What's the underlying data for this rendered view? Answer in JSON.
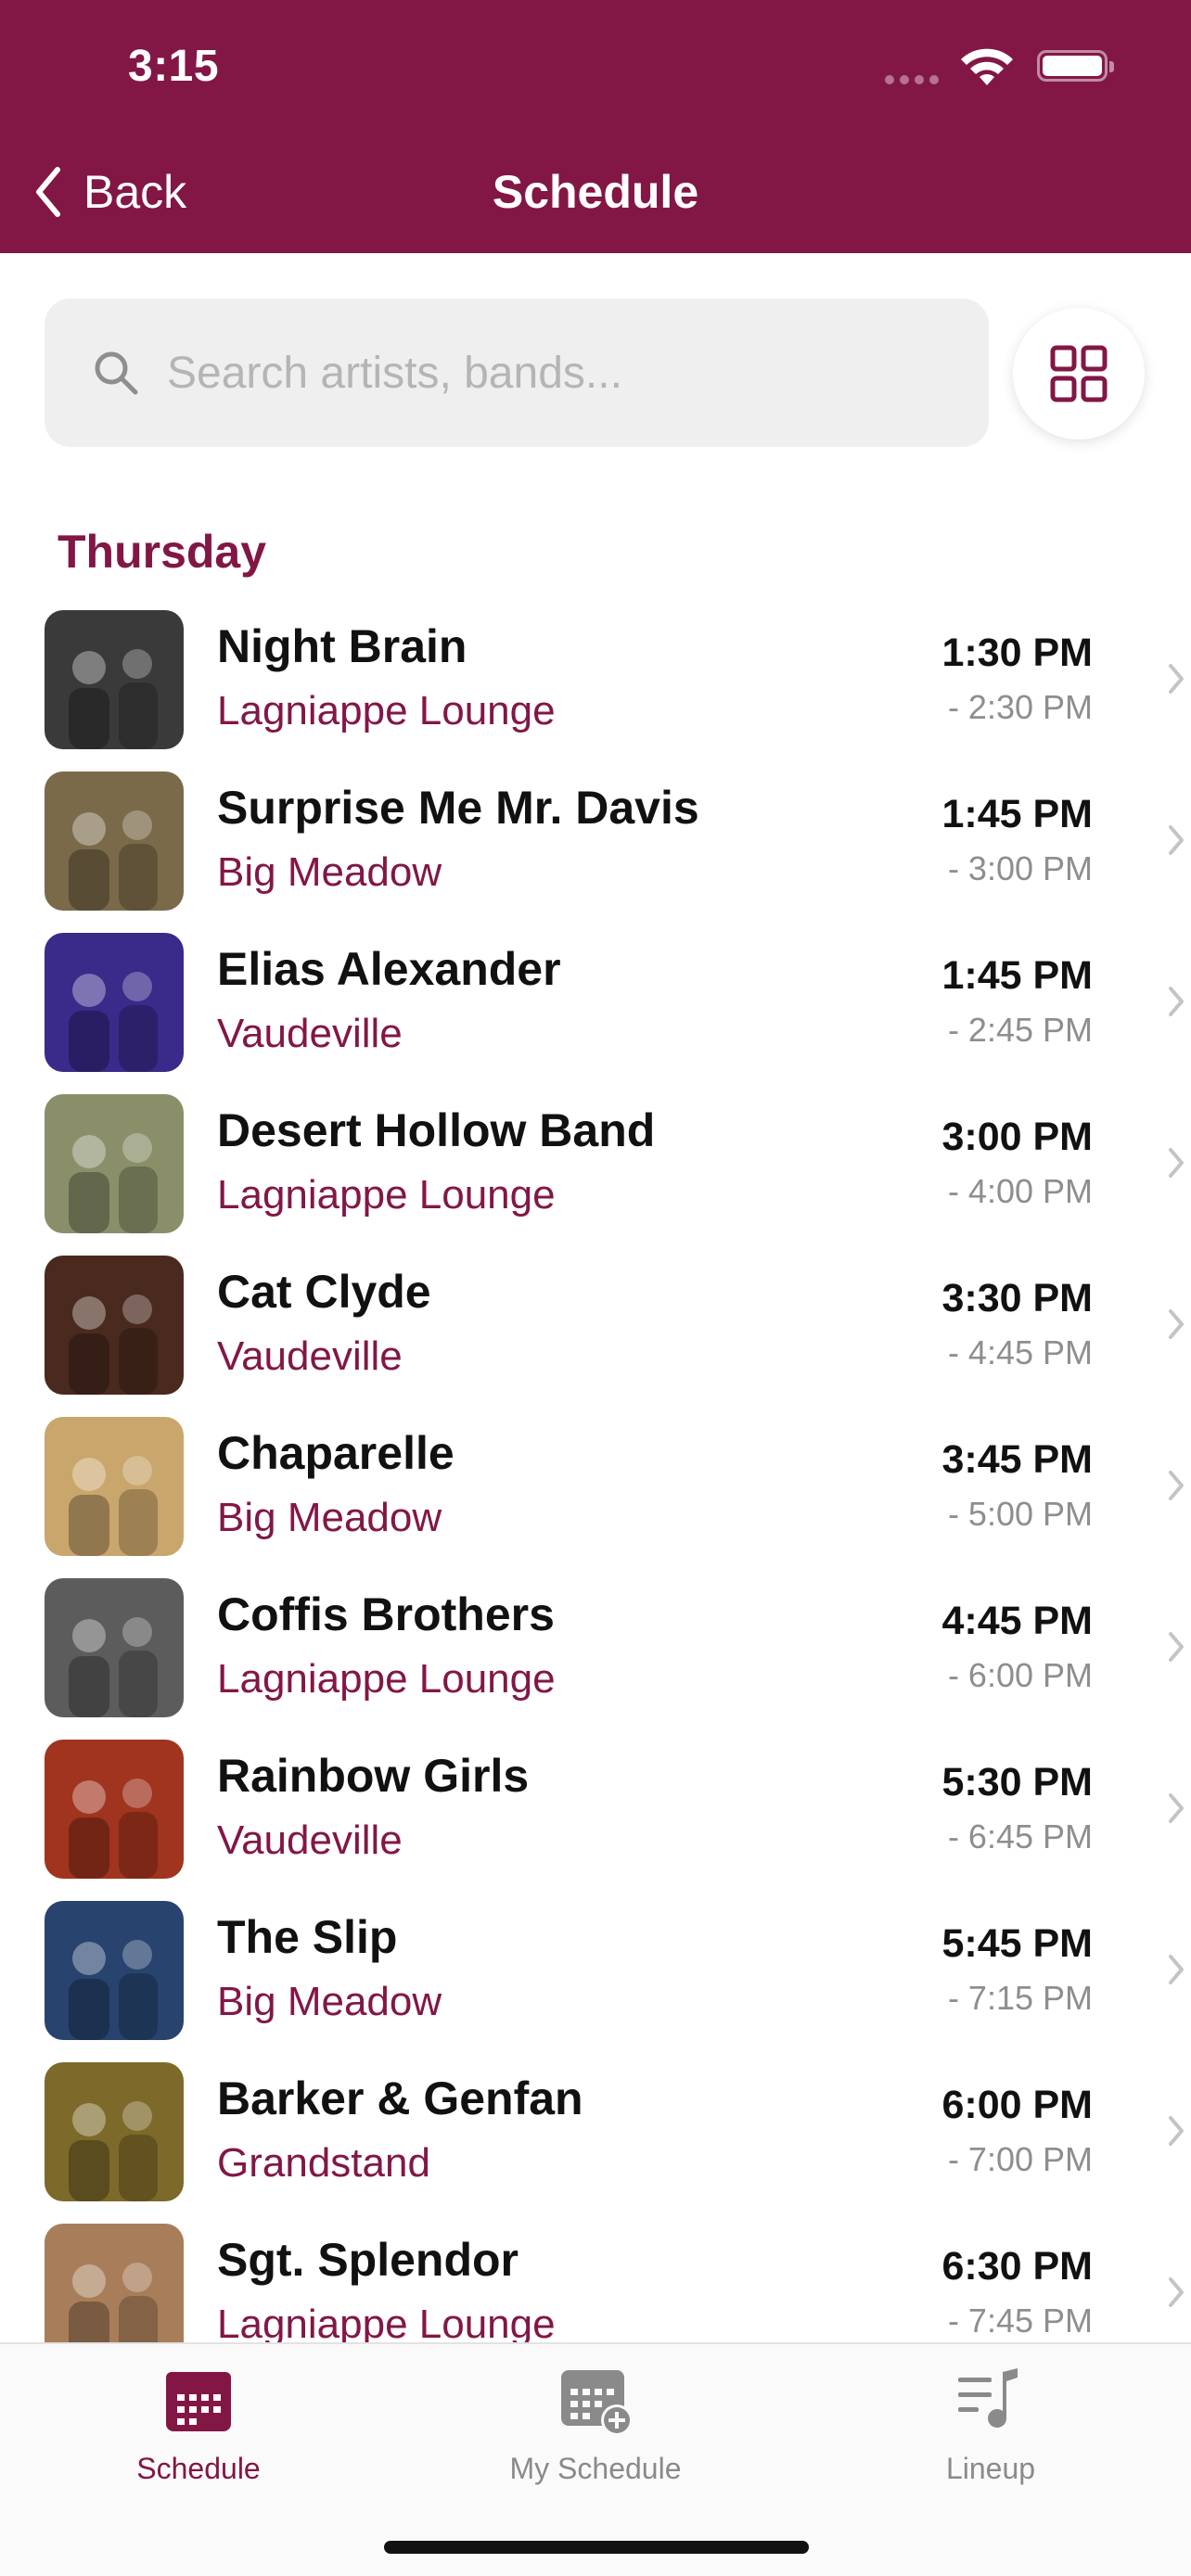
{
  "status_bar": {
    "time": "3:15"
  },
  "nav": {
    "back_label": "Back",
    "title": "Schedule"
  },
  "search": {
    "placeholder": "Search artists, bands..."
  },
  "day": "Thursday",
  "events": [
    {
      "artist": "Night Brain",
      "stage": "Lagniappe Lounge",
      "start": "1:30 PM",
      "end": "- 2:30 PM",
      "photo_tone": "#3a3a3a"
    },
    {
      "artist": "Surprise Me Mr. Davis",
      "stage": "Big Meadow",
      "start": "1:45 PM",
      "end": "- 3:00 PM",
      "photo_tone": "#7a6a4a"
    },
    {
      "artist": "Elias Alexander",
      "stage": "Vaudeville",
      "start": "1:45 PM",
      "end": "- 2:45 PM",
      "photo_tone": "#3a2a8a"
    },
    {
      "artist": "Desert Hollow Band",
      "stage": "Lagniappe Lounge",
      "start": "3:00 PM",
      "end": "- 4:00 PM",
      "photo_tone": "#8a8f6a"
    },
    {
      "artist": "Cat Clyde",
      "stage": "Vaudeville",
      "start": "3:30 PM",
      "end": "- 4:45 PM",
      "photo_tone": "#4a2a1e"
    },
    {
      "artist": "Chaparelle",
      "stage": "Big Meadow",
      "start": "3:45 PM",
      "end": "- 5:00 PM",
      "photo_tone": "#c9a66b"
    },
    {
      "artist": "Coffis Brothers",
      "stage": "Lagniappe Lounge",
      "start": "4:45 PM",
      "end": "- 6:00 PM",
      "photo_tone": "#5c5c5c"
    },
    {
      "artist": "Rainbow Girls",
      "stage": "Vaudeville",
      "start": "5:30 PM",
      "end": "- 6:45 PM",
      "photo_tone": "#a0341e"
    },
    {
      "artist": "The Slip",
      "stage": "Big Meadow",
      "start": "5:45 PM",
      "end": "- 7:15 PM",
      "photo_tone": "#27436e"
    },
    {
      "artist": "Barker & Genfan",
      "stage": "Grandstand",
      "start": "6:00 PM",
      "end": "- 7:00 PM",
      "photo_tone": "#7d6a2a"
    },
    {
      "artist": "Sgt. Splendor",
      "stage": "Lagniappe Lounge",
      "start": "6:30 PM",
      "end": "- 7:45 PM",
      "photo_tone": "#a87e5a"
    }
  ],
  "tabs": [
    {
      "label": "Schedule",
      "icon": "calendar-icon",
      "active": true
    },
    {
      "label": "My Schedule",
      "icon": "calendar-add-icon",
      "active": false
    },
    {
      "label": "Lineup",
      "icon": "music-list-icon",
      "active": false
    }
  ],
  "colors": {
    "brand": "#821746",
    "muted": "#8e8e8e",
    "search_bg": "#efefef"
  }
}
